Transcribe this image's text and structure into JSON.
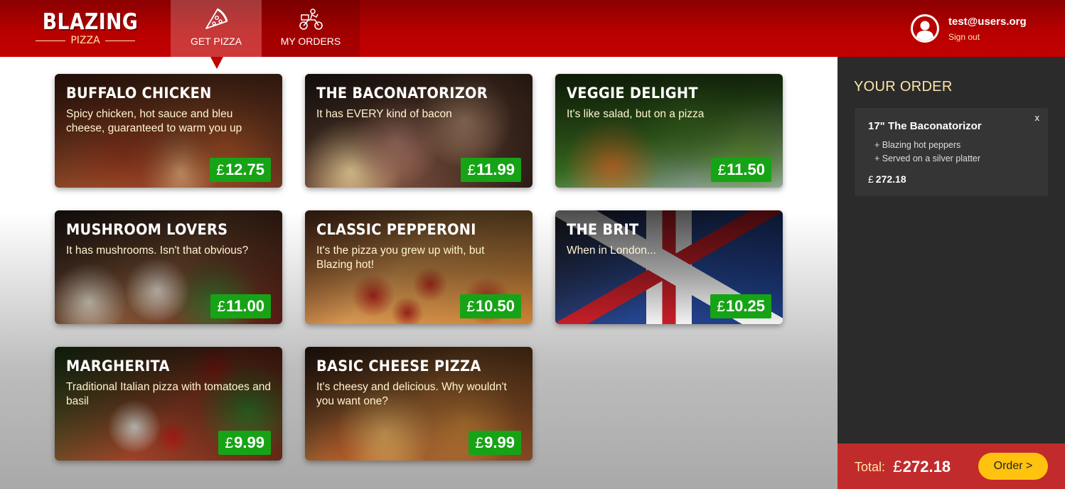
{
  "app": {
    "logo_text": "BLAZING",
    "logo_subtext": "PIZZA"
  },
  "nav": {
    "tabs": [
      {
        "label": "GET PIZZA",
        "icon": "pizza-slice-icon",
        "active": true
      },
      {
        "label": "MY ORDERS",
        "icon": "delivery-scooter-icon",
        "active": false
      }
    ]
  },
  "user": {
    "email": "test@users.org",
    "signout_label": "Sign out",
    "avatar_icon": "user-avatar-icon"
  },
  "pizzas": [
    {
      "name": "Buffalo chicken",
      "description": "Spicy chicken, hot sauce and bleu cheese, guaranteed to warm you up",
      "currency": "£",
      "price": "12.75"
    },
    {
      "name": "The Baconatorizor",
      "description": "It has EVERY kind of bacon",
      "currency": "£",
      "price": "11.99"
    },
    {
      "name": "Veggie Delight",
      "description": "It's like salad, but on a pizza",
      "currency": "£",
      "price": "11.50"
    },
    {
      "name": "Mushroom Lovers",
      "description": "It has mushrooms. Isn't that obvious?",
      "currency": "£",
      "price": "11.00"
    },
    {
      "name": "Classic pepperoni",
      "description": "It's the pizza you grew up with, but Blazing hot!",
      "currency": "£",
      "price": "10.50"
    },
    {
      "name": "The Brit",
      "description": "When in London...",
      "currency": "£",
      "price": "10.25"
    },
    {
      "name": "Margherita",
      "description": "Traditional Italian pizza with tomatoes and basil",
      "currency": "£",
      "price": "9.99"
    },
    {
      "name": "Basic Cheese Pizza",
      "description": "It's cheesy and delicious. Why wouldn't you want one?",
      "currency": "£",
      "price": "9.99"
    }
  ],
  "order": {
    "title": "YOUR ORDER",
    "items": [
      {
        "title": "17\" The Baconatorizor",
        "remove_label": "x",
        "toppings": [
          "+ Blazing hot peppers",
          "+ Served on a silver platter"
        ],
        "currency": "£",
        "price": "272.18"
      }
    ],
    "total_label": "Total:",
    "total_currency": "£",
    "total_value": "272.18",
    "order_button_label": "Order >"
  },
  "colors": {
    "brand_red": "#b70000",
    "price_green": "#17a316",
    "accent_cream": "#ffe7a8",
    "order_button_yellow": "#ffc20e",
    "sidebar_dark": "#2b2b2b",
    "footer_red": "#c22b2b"
  }
}
